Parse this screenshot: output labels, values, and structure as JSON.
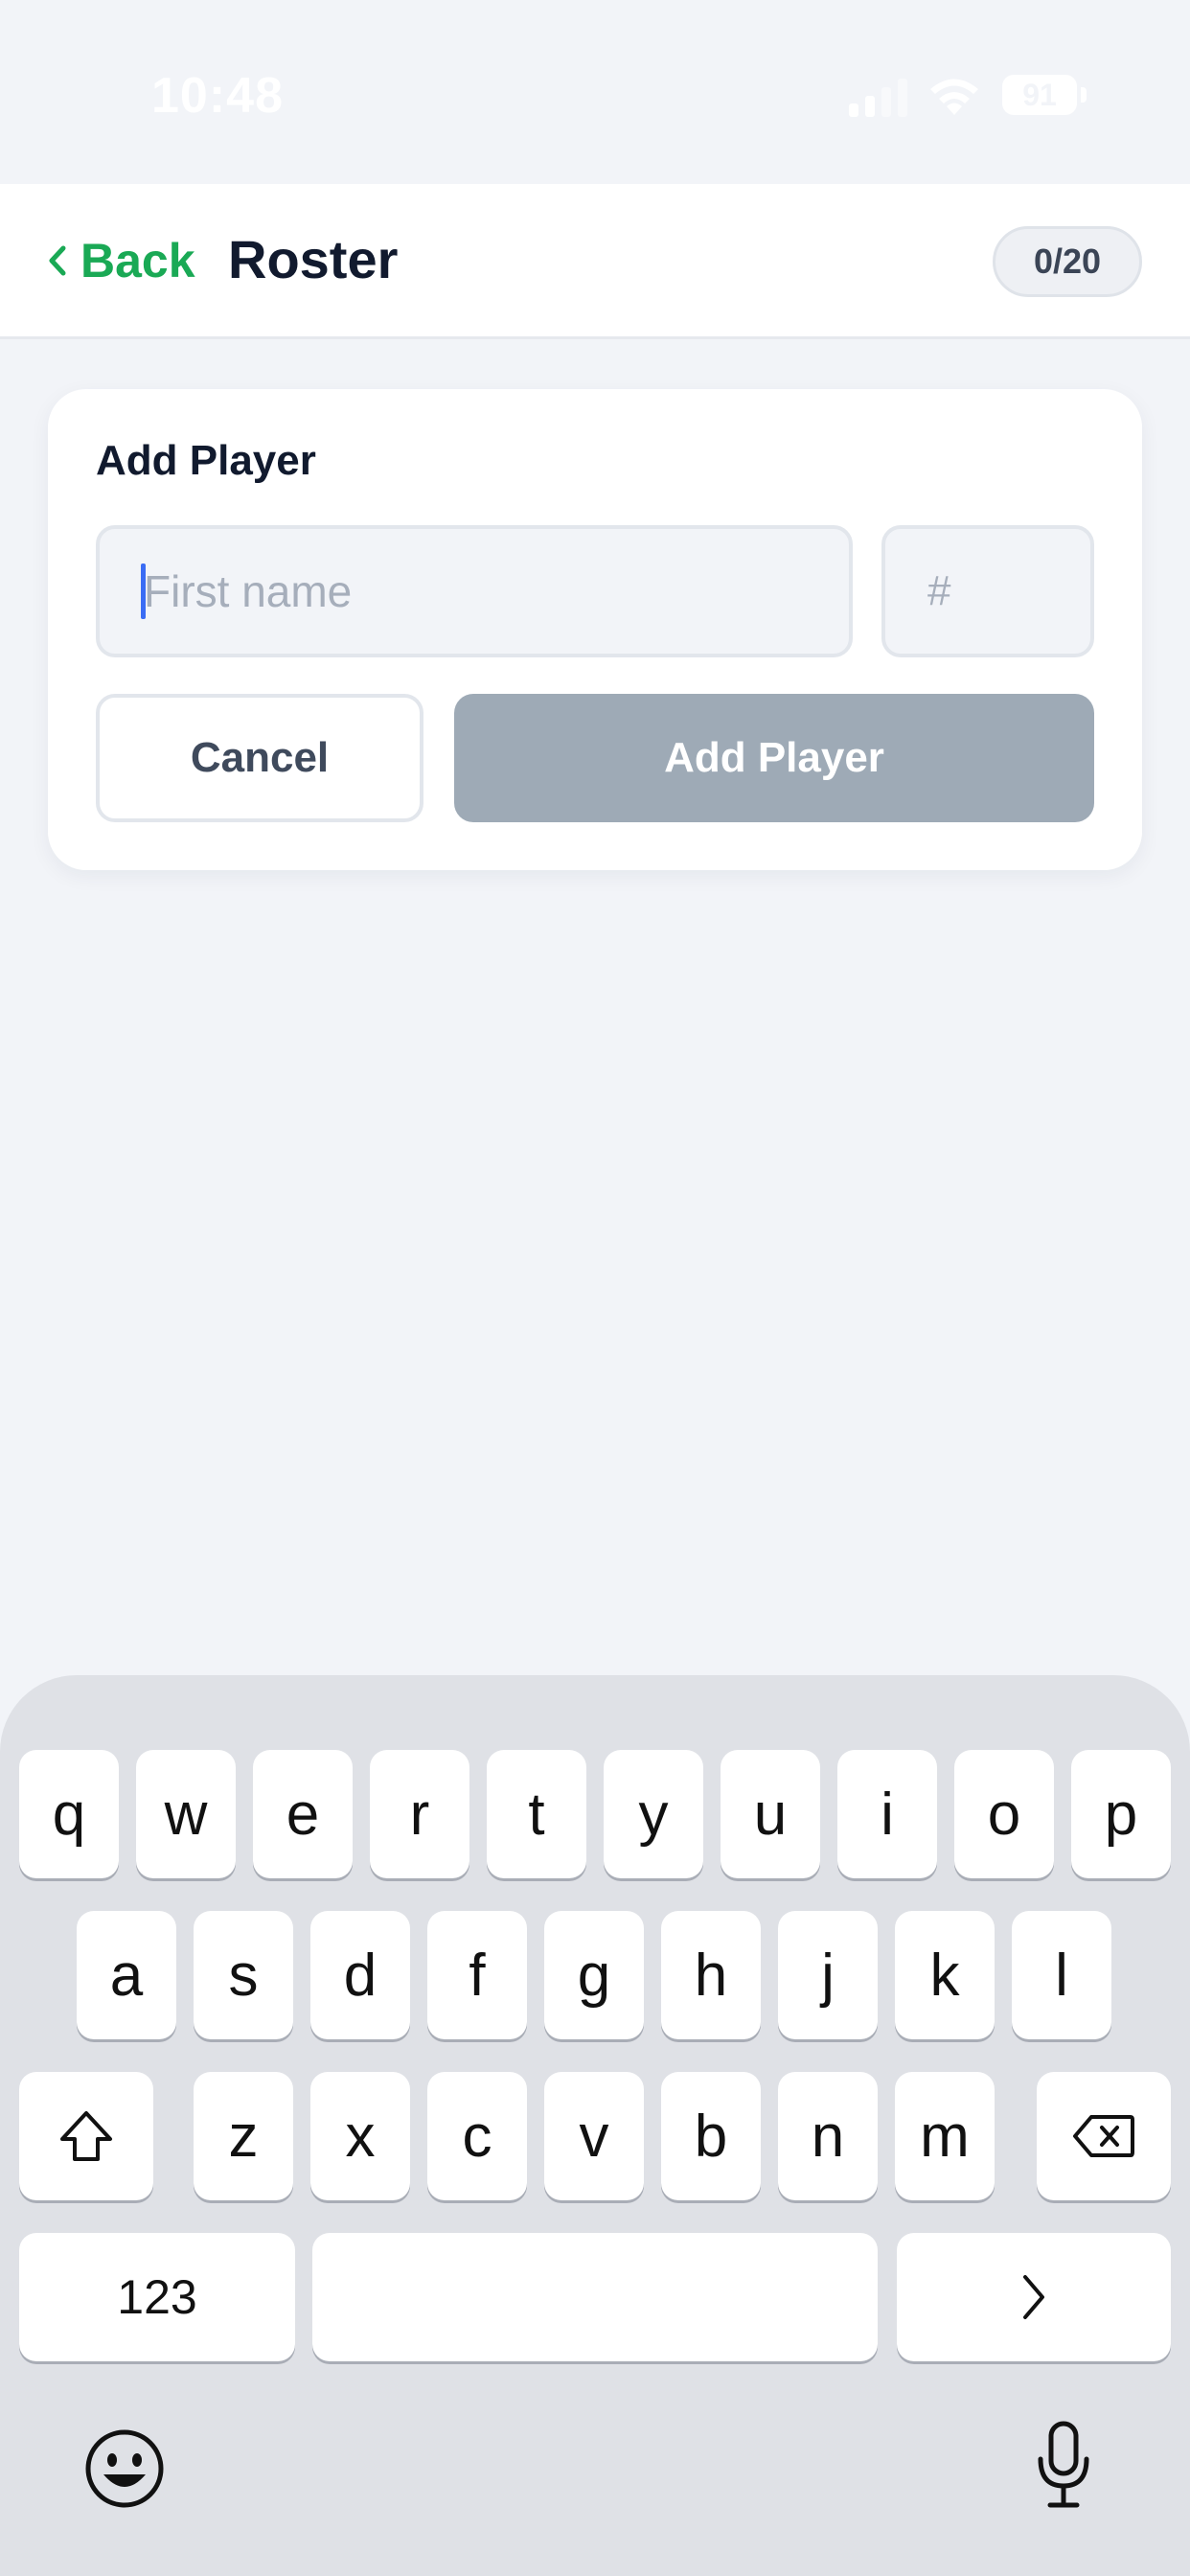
{
  "status_bar": {
    "time": "10:48",
    "battery": "91",
    "icons": [
      "signal-icon",
      "wifi-icon",
      "battery-icon"
    ],
    "color": "#ffffff"
  },
  "header": {
    "back_label": "Back",
    "title": "Roster",
    "player_count": "0/20",
    "accent_color": "#1aa955"
  },
  "add_player_form": {
    "title": "Add Player",
    "name_input": {
      "placeholder": "First name",
      "value": ""
    },
    "number_input": {
      "placeholder": "#",
      "value": ""
    },
    "cancel_label": "Cancel",
    "submit_label": "Add Player",
    "submit_color": "#9eaab6"
  },
  "keyboard": {
    "row1": [
      "q",
      "w",
      "e",
      "r",
      "t",
      "y",
      "u",
      "i",
      "o",
      "p"
    ],
    "row2": [
      "a",
      "s",
      "d",
      "f",
      "g",
      "h",
      "j",
      "k",
      "l"
    ],
    "row3": [
      "z",
      "x",
      "c",
      "v",
      "b",
      "n",
      "m"
    ],
    "numbers_label": "123",
    "icons": [
      "shift-icon",
      "delete-icon",
      "next-icon",
      "emoji-icon",
      "microphone-icon"
    ]
  }
}
